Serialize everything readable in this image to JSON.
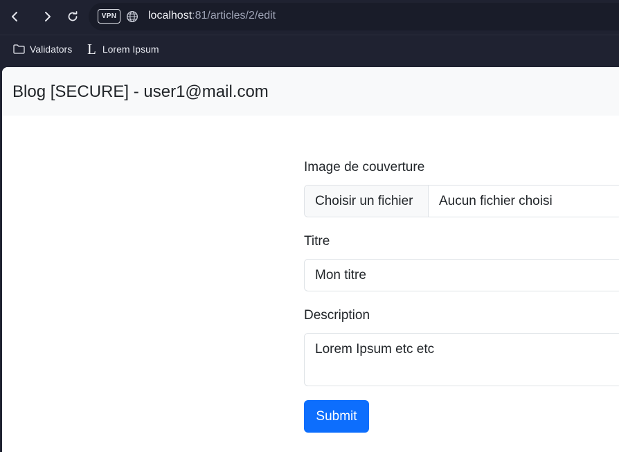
{
  "browser": {
    "vpn_label": "VPN",
    "url_host": "localhost",
    "url_rest": ":81/articles/2/edit",
    "bookmarks": [
      {
        "label": "Validators",
        "icon": "folder-icon"
      },
      {
        "label": "Lorem Ipsum",
        "icon": "bookmark-l-icon",
        "glyph": "L"
      }
    ]
  },
  "page": {
    "brand": "Blog [SECURE] - user1@mail.com",
    "form": {
      "cover_label": "Image de couverture",
      "file_button": "Choisir un fichier",
      "file_status": "Aucun fichier choisi",
      "title_label": "Titre",
      "title_value": "Mon titre",
      "description_label": "Description",
      "description_value": "Lorem Ipsum etc etc",
      "submit_label": "Submit"
    }
  },
  "colors": {
    "chrome_bg": "#1f2231",
    "navbar_bg": "#f8f9fa",
    "primary": "#0d6efd",
    "border": "#dee2e6"
  }
}
